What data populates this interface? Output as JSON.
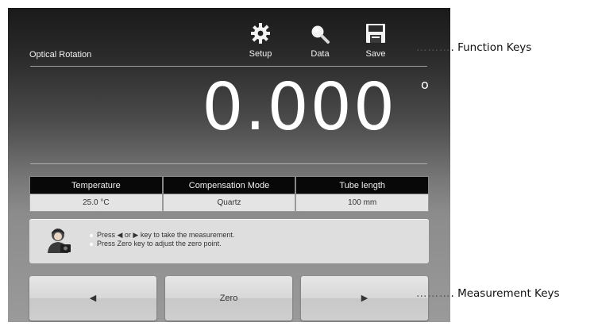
{
  "screen": {
    "title": "Optical Rotation",
    "function_keys": [
      {
        "label": "Setup",
        "icon": "gear-icon"
      },
      {
        "label": "Data",
        "icon": "magnifier-icon"
      },
      {
        "label": "Save",
        "icon": "floppy-disk-icon"
      }
    ],
    "reading": {
      "value": "0.000",
      "unit": "o"
    },
    "table": {
      "headers": [
        "Temperature",
        "Compensation Mode",
        "Tube length"
      ],
      "values": [
        "25.0 °C",
        "Quartz",
        "100 mm"
      ]
    },
    "message": {
      "icon": "operator-avatar-icon",
      "lines": [
        "Press ◀ or ▶ key to take the measurement.",
        "Press Zero key to adjust the zero point."
      ]
    },
    "measurement_keys": {
      "left": "◀",
      "zero": "Zero",
      "right": "▶"
    }
  },
  "annotations": {
    "function_keys_dots": "………",
    "function_keys": ". Function Keys",
    "measurement_keys_dots": "………",
    "measurement_keys": ". Measurement Keys"
  }
}
